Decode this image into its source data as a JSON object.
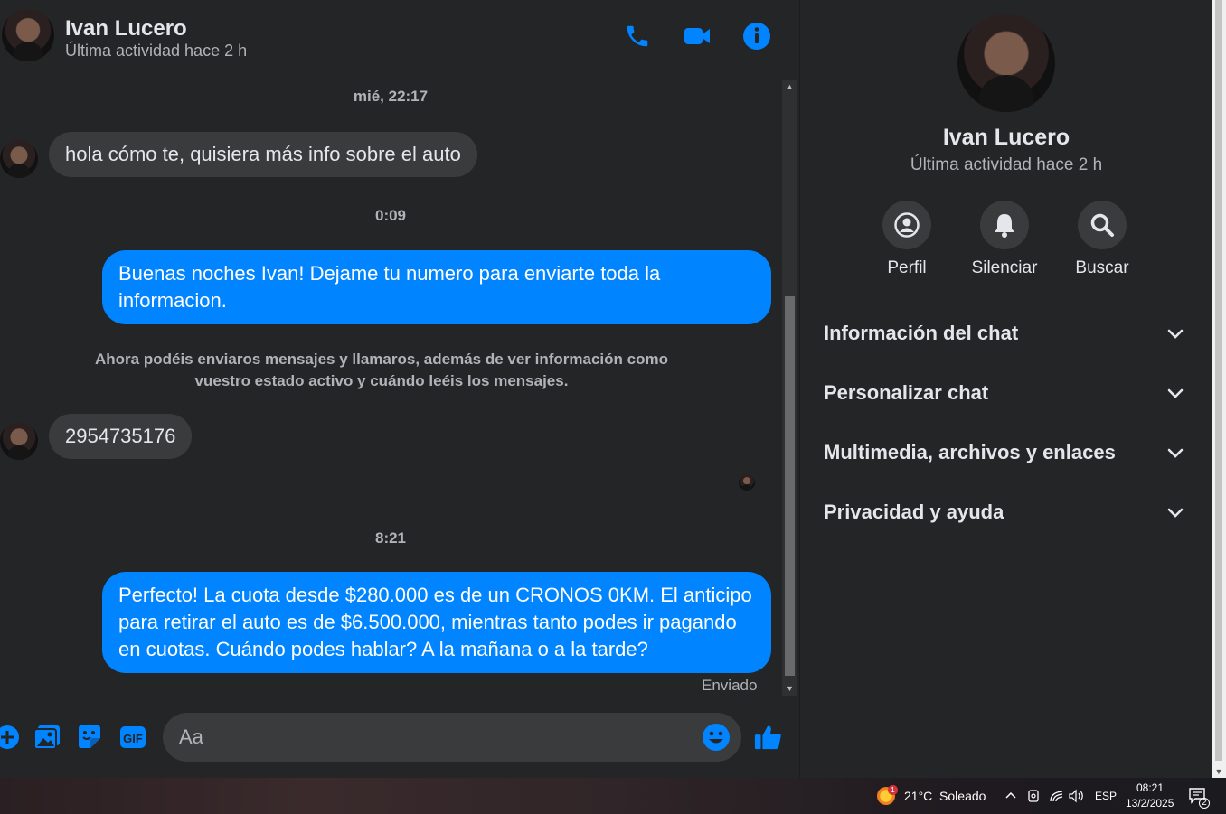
{
  "header": {
    "name": "Ivan Lucero",
    "status": "Última actividad hace 2 h",
    "icons": [
      "phone-icon",
      "video-icon",
      "info-icon"
    ]
  },
  "messages": {
    "ts1": "mié, 22:17",
    "m1": "hola cómo te, quisiera más info sobre el auto",
    "ts2": "0:09",
    "m2": "Buenas noches Ivan! Dejame tu numero para enviarte toda la informacion.",
    "system_note": "Ahora podéis enviaros mensajes y llamaros, además de ver información como vuestro estado activo y cuándo leéis los mensajes.",
    "m3": "2954735176",
    "ts3": "8:21",
    "m4": "Perfecto! La cuota desde $280.000 es de un CRONOS 0KM. El anticipo para retirar el auto es de $6.500.000, mientras tanto podes ir pagando en cuotas. Cuándo podes hablar? A la mañana o a la tarde?",
    "sent_label": "Enviado"
  },
  "composer": {
    "placeholder": "Aa",
    "icons": [
      "plus-icon",
      "image-icon",
      "sticker-icon",
      "gif-icon",
      "emoji-icon",
      "like-icon"
    ],
    "gif_label": "GIF"
  },
  "side": {
    "name": "Ivan Lucero",
    "status": "Última actividad hace 2 h",
    "actions": [
      {
        "label": "Perfil",
        "icon": "profile-icon"
      },
      {
        "label": "Silenciar",
        "icon": "bell-icon"
      },
      {
        "label": "Buscar",
        "icon": "search-icon"
      }
    ],
    "sections": [
      "Información del chat",
      "Personalizar chat",
      "Multimedia, archivos y enlaces",
      "Privacidad y ayuda"
    ]
  },
  "taskbar": {
    "weather": "21°C  Soleado",
    "weather_badge": "1",
    "lang": "ESP",
    "time": "08:21",
    "date": "13/2/2025",
    "notif_count": "2"
  },
  "colors": {
    "accent": "#0084ff",
    "bubble_in": "#3a3b3c",
    "background": "#242526"
  }
}
